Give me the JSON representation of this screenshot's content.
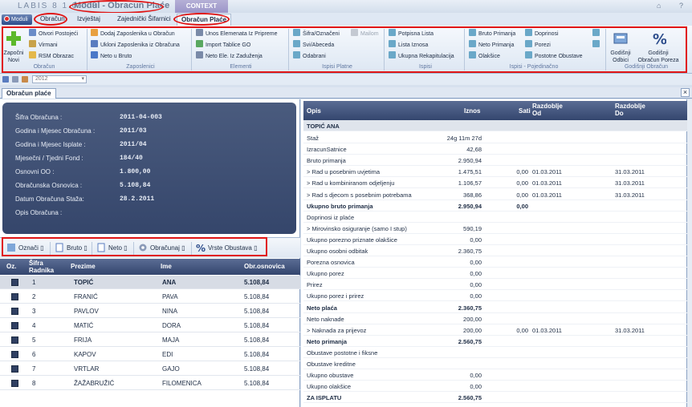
{
  "titlebar": {
    "app_title": "LABIS 8 1.0.0.3",
    "module_title": "Modul - Obracun Plaće",
    "context_label": "CONTEXT",
    "help_icon": "help-icon",
    "minimize_icon": "minimize-icon"
  },
  "tabs": {
    "modul": "Moduli",
    "obracun": "Obračun",
    "izvjestaj": "Izvještaj",
    "zajednicki": "Zajednički Šifarnici",
    "obracun_place": "Obračun Plaće"
  },
  "ribbon": {
    "zapocni_novi_1": "Započni",
    "zapocni_novi_2": "Novi",
    "obracun_items": [
      "Otvori Postojeći",
      "Virmani",
      "RSM Obrazac"
    ],
    "obracun_label": "Obračun",
    "zaposlenici_items": [
      "Dodaj Zaposlenika u Obračun",
      "Ukloni Zaposlenika iz Obračuna",
      "Neto u Bruto"
    ],
    "zaposlenici_label": "Zaposlenici",
    "elementi_items": [
      "Unos Elemenata Iz Pripreme",
      "Import Tablice GO",
      "Neto Ele. Iz Zaduženja"
    ],
    "elementi_label": "Elementi",
    "platne_items": [
      "Šifra/Označeni",
      "Mailom",
      "Svi/Abeceda",
      "Odabrani"
    ],
    "platne_label": "Ispisi Platne",
    "ispisi_items": [
      "Potpisna Lista",
      "Lista Iznosa",
      "Ukupna Rekapitulacija"
    ],
    "ispisi_label": "Ispisi",
    "pojedinacno_items": [
      "Bruto Primanja",
      "Neto Primanja",
      "Olakšice",
      "Doprinosi",
      "Porezi",
      "Postotne Obustave"
    ],
    "pojedinacno_label": "Ispisi - Pojedinačno",
    "godisnji_odbici": [
      "Godišnji",
      "Odbici"
    ],
    "godisnji_porez": [
      "Godišnji",
      "Obračun Poreza"
    ],
    "godisnji_label": "Godišnji Obračun"
  },
  "qat": {
    "year": "2012"
  },
  "doc_tab": "Obračun plaće",
  "info": {
    "rows": [
      {
        "label": "Šifra Obračuna :",
        "value": "2011-04-003"
      },
      {
        "label": "Godina i Mjesec Obračuna :",
        "value": "2011/03"
      },
      {
        "label": "Godina i Mjesec Isplate :",
        "value": "2011/04"
      },
      {
        "label": "Mjesečni / Tjedni Fond :",
        "value": "184/40"
      },
      {
        "label": "Osnovni OO :",
        "value": "1.800,00"
      },
      {
        "label": "Obračunska Osnovica :",
        "value": "5.108,84"
      },
      {
        "label": "Datum Obračuna Staža:",
        "value": "28.2.2011"
      },
      {
        "label": "Opis Obračuna :",
        "value": ""
      }
    ]
  },
  "grid_toolbar": {
    "oznaci": "Označi",
    "bruto": "Bruto",
    "neto": "Neto",
    "obracunaj": "Obračunaj",
    "vrste_obustava": "Vrste Obustava",
    "dropdown_glyph": "▯"
  },
  "employees": {
    "headers": {
      "oz": "Oz.",
      "sifra_1": "Šifra",
      "sifra_2": "Radnika",
      "prezime": "Prezime",
      "ime": "Ime",
      "osnovica": "Obr.osnovica"
    },
    "rows": [
      {
        "sifra": "1",
        "prezime": "TOPIĆ",
        "ime": "ANA",
        "osnovica": "5.108,84"
      },
      {
        "sifra": "2",
        "prezime": "FRANIĆ",
        "ime": "PAVA",
        "osnovica": "5.108,84"
      },
      {
        "sifra": "3",
        "prezime": "PAVLOV",
        "ime": "NINA",
        "osnovica": "5.108,84"
      },
      {
        "sifra": "4",
        "prezime": "MATIĆ",
        "ime": "DORA",
        "osnovica": "5.108,84"
      },
      {
        "sifra": "5",
        "prezime": "FRIJA",
        "ime": "MAJA",
        "osnovica": "5.108,84"
      },
      {
        "sifra": "6",
        "prezime": "KAPOV",
        "ime": "EDI",
        "osnovica": "5.108,84"
      },
      {
        "sifra": "7",
        "prezime": "VRTLAR",
        "ime": "GAJO",
        "osnovica": "5.108,84"
      },
      {
        "sifra": "8",
        "prezime": "ŽAŽABRUŽIĆ",
        "ime": "FILOMENICA",
        "osnovica": "5.108,84"
      }
    ]
  },
  "details": {
    "headers": {
      "opis": "Opis",
      "iznos": "Iznos",
      "sati": "Sati",
      "od_1": "Razdoblje",
      "od_2": "Od",
      "do_1": "Razdoblje",
      "do_2": "Do"
    },
    "group": "TOPIĆ ANA",
    "rows": [
      {
        "opis": "Staž",
        "iznos": "24g 11m 27d",
        "sati": "",
        "od": "",
        "do": "",
        "bold": false
      },
      {
        "opis": "IzracunSatnice",
        "iznos": "42,68",
        "sati": "",
        "od": "",
        "do": "",
        "bold": false
      },
      {
        "opis": "Bruto primanja",
        "iznos": "2.950,94",
        "sati": "",
        "od": "",
        "do": "",
        "bold": false
      },
      {
        "opis": "  >  Rad u posebnim uvjetima",
        "iznos": "1.475,51",
        "sati": "0,00",
        "od": "01.03.2011",
        "do": "31.03.2011",
        "bold": false
      },
      {
        "opis": "  >  Rad u kombiniranom odjeljenju",
        "iznos": "1.106,57",
        "sati": "0,00",
        "od": "01.03.2011",
        "do": "31.03.2011",
        "bold": false
      },
      {
        "opis": "  >  Rad s djecom s posebnim potrebama",
        "iznos": "368,86",
        "sati": "0,00",
        "od": "01.03.2011",
        "do": "31.03.2011",
        "bold": false
      },
      {
        "opis": "Ukupno bruto primanja",
        "iznos": "2.950,94",
        "sati": "0,00",
        "od": "",
        "do": "",
        "bold": true
      },
      {
        "opis": "Doprinosi iz plaće",
        "iznos": "",
        "sati": "",
        "od": "",
        "do": "",
        "bold": false
      },
      {
        "opis": "  >  Mirovinsko osiguranje (samo I stup)",
        "iznos": "590,19",
        "sati": "",
        "od": "",
        "do": "",
        "bold": false
      },
      {
        "opis": "Ukupno porezno priznate olakšice",
        "iznos": "0,00",
        "sati": "",
        "od": "",
        "do": "",
        "bold": false
      },
      {
        "opis": "Ukupno osobni odbitak",
        "iznos": "2.360,75",
        "sati": "",
        "od": "",
        "do": "",
        "bold": false
      },
      {
        "opis": "Porezna osnovica",
        "iznos": "0,00",
        "sati": "",
        "od": "",
        "do": "",
        "bold": false
      },
      {
        "opis": "Ukupno porez",
        "iznos": "0,00",
        "sati": "",
        "od": "",
        "do": "",
        "bold": false
      },
      {
        "opis": "Prirez",
        "iznos": "0,00",
        "sati": "",
        "od": "",
        "do": "",
        "bold": false
      },
      {
        "opis": "Ukupno porez i prirez",
        "iznos": "0,00",
        "sati": "",
        "od": "",
        "do": "",
        "bold": false
      },
      {
        "opis": "Neto plaća",
        "iznos": "2.360,75",
        "sati": "",
        "od": "",
        "do": "",
        "bold": true
      },
      {
        "opis": "Neto naknade",
        "iznos": "200,00",
        "sati": "",
        "od": "",
        "do": "",
        "bold": false
      },
      {
        "opis": "  >  Naknada za prijevoz",
        "iznos": "200,00",
        "sati": "0,00",
        "od": "01.03.2011",
        "do": "31.03.2011",
        "bold": false
      },
      {
        "opis": "Neto primanja",
        "iznos": "2.560,75",
        "sati": "",
        "od": "",
        "do": "",
        "bold": true
      },
      {
        "opis": "Obustave postotne i fiksne",
        "iznos": "",
        "sati": "",
        "od": "",
        "do": "",
        "bold": false
      },
      {
        "opis": "Obustave kreditne",
        "iznos": "",
        "sati": "",
        "od": "",
        "do": "",
        "bold": false
      },
      {
        "opis": "Ukupno obustave",
        "iznos": "0,00",
        "sati": "",
        "od": "",
        "do": "",
        "bold": false
      },
      {
        "opis": "Ukupno olakšice",
        "iznos": "0,00",
        "sati": "",
        "od": "",
        "do": "",
        "bold": false
      },
      {
        "opis": "ZA ISPLATU",
        "iznos": "2.560,75",
        "sati": "",
        "od": "",
        "do": "",
        "bold": true
      }
    ]
  },
  "colors": {
    "header_bg": "#34466e",
    "highlight_red": "#e01515",
    "accent_blue": "#2d4d8c"
  }
}
